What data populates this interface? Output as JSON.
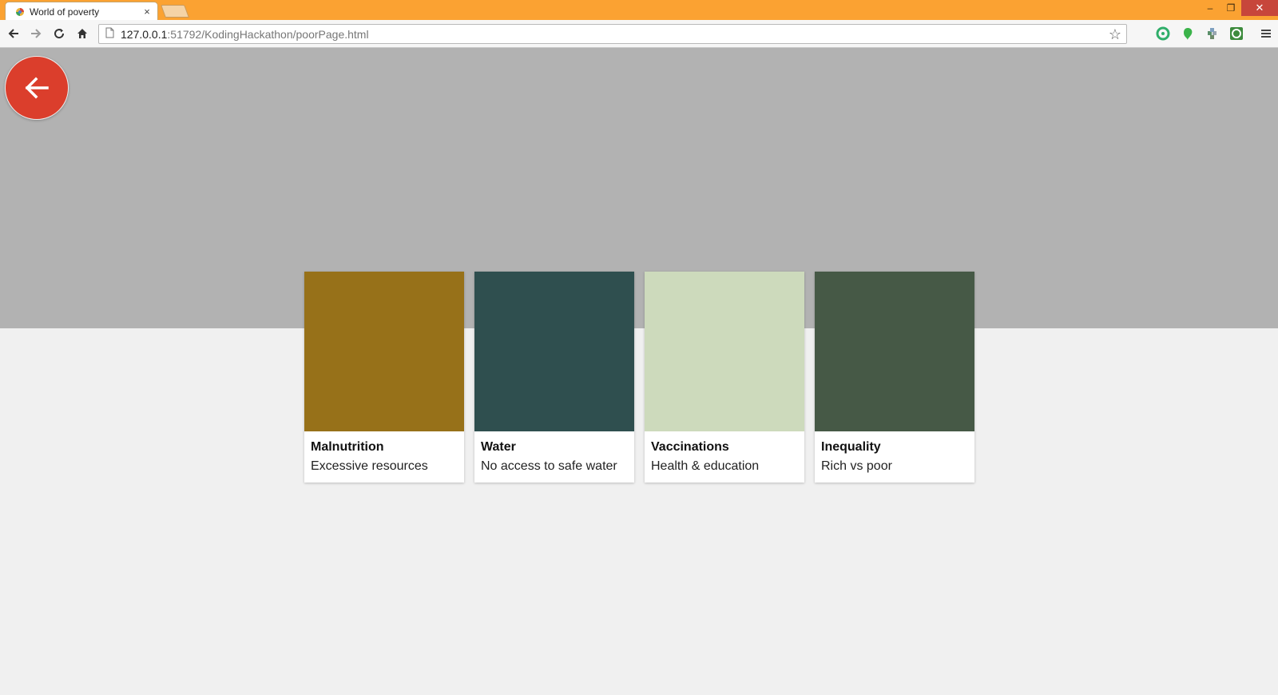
{
  "browser": {
    "tab_title": "World of poverty",
    "tab_close": "×",
    "url_host": "127.0.0.1",
    "url_rest": ":51792/KodingHackathon/poorPage.html",
    "window_controls": {
      "minimize": "‒",
      "restore": "❐",
      "close": "✕"
    },
    "icons": [
      "back-icon",
      "forward-icon",
      "reload-icon",
      "home-icon",
      "page-icon",
      "star-icon",
      "menu-icon"
    ],
    "extensions": [
      "green-ring-extension",
      "green-leaf-extension",
      "puzzle-extension",
      "green-square-extension"
    ],
    "accent_color": "#fba232"
  },
  "page": {
    "hero_color": "#b2b2b2",
    "background_color": "#f0f0f0",
    "back_button_color": "#db3e2c",
    "cards": [
      {
        "title": "Malnutrition",
        "subtitle": "Excessive resources",
        "color": "#977119"
      },
      {
        "title": "Water",
        "subtitle": "No access to safe water",
        "color": "#2f4f4f"
      },
      {
        "title": "Vaccinations",
        "subtitle": "Health & education",
        "color": "#cddabc"
      },
      {
        "title": "Inequality",
        "subtitle": "Rich vs poor",
        "color": "#465946"
      }
    ]
  }
}
